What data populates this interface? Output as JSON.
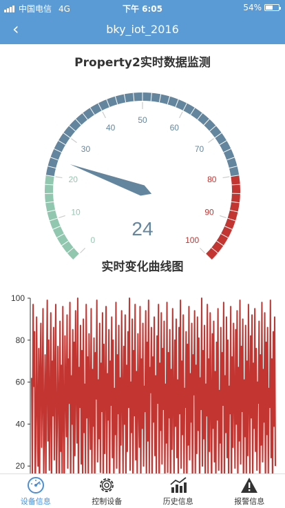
{
  "status_bar": {
    "carrier": "中国电信",
    "network": "4G",
    "time": "下午 6:05",
    "battery": "54%"
  },
  "nav": {
    "title": "bky_iot_2016"
  },
  "gauge": {
    "title": "Property2实时数据监测",
    "value": 24,
    "value_text": "24",
    "min": 0,
    "max": 100,
    "ticks": [
      "0",
      "10",
      "20",
      "30",
      "40",
      "50",
      "60",
      "70",
      "80",
      "90",
      "100"
    ],
    "colors": {
      "low": "#91c7ae",
      "mid": "#63869e",
      "high": "#c23531"
    }
  },
  "chart_title": "实时变化曲线图",
  "chart_data": {
    "type": "line",
    "ylim": [
      0,
      100
    ],
    "yticks": [
      "100",
      "80",
      "60",
      "40",
      "20"
    ],
    "grid": false,
    "series": [
      {
        "values": [
          62,
          12,
          97,
          58,
          84,
          8,
          35,
          91,
          47,
          20,
          76,
          3,
          66,
          88,
          29,
          54,
          95,
          14,
          41,
          73,
          9,
          60,
          99,
          32,
          80,
          18,
          51,
          93,
          5,
          70,
          44,
          86,
          23,
          64,
          97,
          11,
          38,
          77,
          52,
          2,
          89,
          27,
          68,
          15,
          96,
          45,
          7,
          82,
          58,
          34,
          92,
          19,
          71,
          50,
          98,
          6,
          63,
          40,
          85,
          13,
          79,
          25,
          94,
          57,
          31,
          100,
          4,
          67,
          48,
          87,
          21,
          75,
          10,
          90,
          36,
          59,
          16,
          97,
          43,
          72,
          8,
          83,
          55,
          28,
          95,
          12,
          66,
          39,
          81,
          3,
          74,
          52,
          99,
          22,
          61,
          33,
          88,
          17,
          69,
          46,
          93,
          7,
          78,
          26,
          58,
          96,
          14,
          64,
          42,
          85,
          1,
          70,
          49,
          91,
          24,
          80,
          11,
          57,
          35,
          98,
          19,
          73,
          45,
          87,
          6,
          62,
          30,
          94,
          53,
          15,
          77,
          40,
          92,
          9,
          68,
          27,
          84,
          48,
          100,
          18,
          60,
          36,
          90,
          5,
          75,
          44,
          97,
          23,
          65,
          13,
          83,
          51,
          29,
          96,
          8,
          71,
          38,
          88,
          20,
          58,
          46,
          94,
          11,
          79,
          32,
          99,
          16,
          67,
          55,
          86,
          4,
          72,
          41,
          91,
          25,
          63,
          14,
          82,
          50,
          97,
          2,
          69,
          37,
          93,
          21,
          76,
          47,
          89,
          10,
          59,
          31,
          98,
          17,
          74,
          43,
          85,
          7,
          66,
          28,
          95,
          52,
          12,
          80,
          39,
          90,
          24,
          61,
          8,
          86,
          45,
          99,
          19,
          70,
          35,
          92,
          13,
          57,
          48,
          84,
          3,
          78,
          30,
          96,
          23,
          64,
          41,
          88,
          6,
          73,
          54,
          94,
          15,
          68,
          26,
          91,
          37,
          81,
          11,
          62,
          47,
          100,
          20,
          75,
          33,
          87,
          9,
          59,
          44,
          97,
          16,
          71,
          27,
          93,
          51,
          5,
          83,
          38,
          89,
          22,
          65,
          12,
          79,
          42,
          95,
          18,
          56,
          31,
          86,
          7,
          74,
          49,
          98,
          14,
          63,
          36,
          91,
          24,
          80,
          10,
          58,
          45,
          96,
          3,
          72,
          29,
          88,
          53,
          19,
          85,
          40,
          94,
          11,
          67,
          32,
          99,
          21,
          77,
          46,
          90,
          8,
          61,
          34,
          87,
          15,
          70,
          25,
          97,
          55,
          13,
          82,
          43,
          92,
          6,
          69,
          38,
          95,
          27,
          76,
          18,
          60,
          50,
          89,
          4,
          73,
          30,
          98,
          22,
          66,
          41,
          93,
          9,
          79,
          35,
          86,
          14,
          57,
          48,
          99,
          24,
          71,
          12,
          84,
          39,
          91,
          20
        ]
      }
    ]
  },
  "tabs": [
    {
      "label": "设备信息",
      "icon": "gauge-icon",
      "active": true
    },
    {
      "label": "控制设备",
      "icon": "gear-icon",
      "active": false
    },
    {
      "label": "历史信息",
      "icon": "trend-chart-icon",
      "active": false
    },
    {
      "label": "报警信息",
      "icon": "warning-icon",
      "active": false
    }
  ]
}
